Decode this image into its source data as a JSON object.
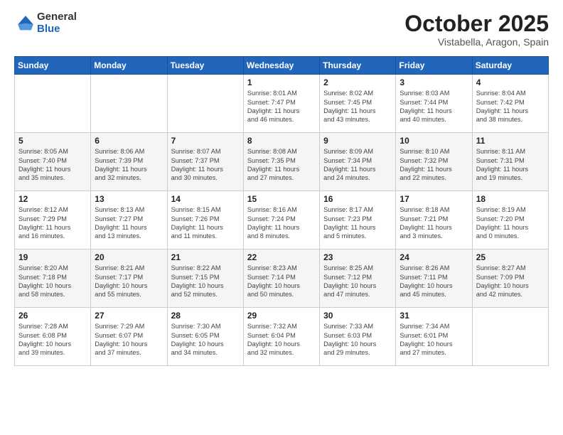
{
  "header": {
    "logo_general": "General",
    "logo_blue": "Blue",
    "title": "October 2025",
    "location": "Vistabella, Aragon, Spain"
  },
  "weekdays": [
    "Sunday",
    "Monday",
    "Tuesday",
    "Wednesday",
    "Thursday",
    "Friday",
    "Saturday"
  ],
  "weeks": [
    [
      {
        "day": "",
        "content": ""
      },
      {
        "day": "",
        "content": ""
      },
      {
        "day": "",
        "content": ""
      },
      {
        "day": "1",
        "content": "Sunrise: 8:01 AM\nSunset: 7:47 PM\nDaylight: 11 hours\nand 46 minutes."
      },
      {
        "day": "2",
        "content": "Sunrise: 8:02 AM\nSunset: 7:45 PM\nDaylight: 11 hours\nand 43 minutes."
      },
      {
        "day": "3",
        "content": "Sunrise: 8:03 AM\nSunset: 7:44 PM\nDaylight: 11 hours\nand 40 minutes."
      },
      {
        "day": "4",
        "content": "Sunrise: 8:04 AM\nSunset: 7:42 PM\nDaylight: 11 hours\nand 38 minutes."
      }
    ],
    [
      {
        "day": "5",
        "content": "Sunrise: 8:05 AM\nSunset: 7:40 PM\nDaylight: 11 hours\nand 35 minutes."
      },
      {
        "day": "6",
        "content": "Sunrise: 8:06 AM\nSunset: 7:39 PM\nDaylight: 11 hours\nand 32 minutes."
      },
      {
        "day": "7",
        "content": "Sunrise: 8:07 AM\nSunset: 7:37 PM\nDaylight: 11 hours\nand 30 minutes."
      },
      {
        "day": "8",
        "content": "Sunrise: 8:08 AM\nSunset: 7:35 PM\nDaylight: 11 hours\nand 27 minutes."
      },
      {
        "day": "9",
        "content": "Sunrise: 8:09 AM\nSunset: 7:34 PM\nDaylight: 11 hours\nand 24 minutes."
      },
      {
        "day": "10",
        "content": "Sunrise: 8:10 AM\nSunset: 7:32 PM\nDaylight: 11 hours\nand 22 minutes."
      },
      {
        "day": "11",
        "content": "Sunrise: 8:11 AM\nSunset: 7:31 PM\nDaylight: 11 hours\nand 19 minutes."
      }
    ],
    [
      {
        "day": "12",
        "content": "Sunrise: 8:12 AM\nSunset: 7:29 PM\nDaylight: 11 hours\nand 16 minutes."
      },
      {
        "day": "13",
        "content": "Sunrise: 8:13 AM\nSunset: 7:27 PM\nDaylight: 11 hours\nand 13 minutes."
      },
      {
        "day": "14",
        "content": "Sunrise: 8:15 AM\nSunset: 7:26 PM\nDaylight: 11 hours\nand 11 minutes."
      },
      {
        "day": "15",
        "content": "Sunrise: 8:16 AM\nSunset: 7:24 PM\nDaylight: 11 hours\nand 8 minutes."
      },
      {
        "day": "16",
        "content": "Sunrise: 8:17 AM\nSunset: 7:23 PM\nDaylight: 11 hours\nand 5 minutes."
      },
      {
        "day": "17",
        "content": "Sunrise: 8:18 AM\nSunset: 7:21 PM\nDaylight: 11 hours\nand 3 minutes."
      },
      {
        "day": "18",
        "content": "Sunrise: 8:19 AM\nSunset: 7:20 PM\nDaylight: 11 hours\nand 0 minutes."
      }
    ],
    [
      {
        "day": "19",
        "content": "Sunrise: 8:20 AM\nSunset: 7:18 PM\nDaylight: 10 hours\nand 58 minutes."
      },
      {
        "day": "20",
        "content": "Sunrise: 8:21 AM\nSunset: 7:17 PM\nDaylight: 10 hours\nand 55 minutes."
      },
      {
        "day": "21",
        "content": "Sunrise: 8:22 AM\nSunset: 7:15 PM\nDaylight: 10 hours\nand 52 minutes."
      },
      {
        "day": "22",
        "content": "Sunrise: 8:23 AM\nSunset: 7:14 PM\nDaylight: 10 hours\nand 50 minutes."
      },
      {
        "day": "23",
        "content": "Sunrise: 8:25 AM\nSunset: 7:12 PM\nDaylight: 10 hours\nand 47 minutes."
      },
      {
        "day": "24",
        "content": "Sunrise: 8:26 AM\nSunset: 7:11 PM\nDaylight: 10 hours\nand 45 minutes."
      },
      {
        "day": "25",
        "content": "Sunrise: 8:27 AM\nSunset: 7:09 PM\nDaylight: 10 hours\nand 42 minutes."
      }
    ],
    [
      {
        "day": "26",
        "content": "Sunrise: 7:28 AM\nSunset: 6:08 PM\nDaylight: 10 hours\nand 39 minutes."
      },
      {
        "day": "27",
        "content": "Sunrise: 7:29 AM\nSunset: 6:07 PM\nDaylight: 10 hours\nand 37 minutes."
      },
      {
        "day": "28",
        "content": "Sunrise: 7:30 AM\nSunset: 6:05 PM\nDaylight: 10 hours\nand 34 minutes."
      },
      {
        "day": "29",
        "content": "Sunrise: 7:32 AM\nSunset: 6:04 PM\nDaylight: 10 hours\nand 32 minutes."
      },
      {
        "day": "30",
        "content": "Sunrise: 7:33 AM\nSunset: 6:03 PM\nDaylight: 10 hours\nand 29 minutes."
      },
      {
        "day": "31",
        "content": "Sunrise: 7:34 AM\nSunset: 6:01 PM\nDaylight: 10 hours\nand 27 minutes."
      },
      {
        "day": "",
        "content": ""
      }
    ]
  ]
}
